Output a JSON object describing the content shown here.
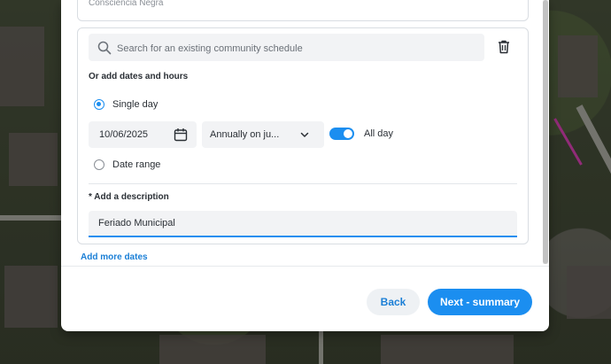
{
  "previous_card": {
    "text": "Consciência Negra"
  },
  "schedule": {
    "search_placeholder": "Search for an existing community schedule",
    "or_add_label": "Or add dates and hours",
    "single_day_label": "Single day",
    "date_value": "10/06/2025",
    "repeat_value": "Annually on ju...",
    "all_day_label": "All day",
    "all_day_on": true,
    "date_range_label": "Date range",
    "description_label": "* Add a description",
    "description_value": "Feriado Municipal"
  },
  "add_more_label": "Add more dates",
  "footer": {
    "back_label": "Back",
    "next_label": "Next - summary"
  },
  "colors": {
    "accent": "#1b8ef0",
    "link": "#1b7fd6"
  }
}
